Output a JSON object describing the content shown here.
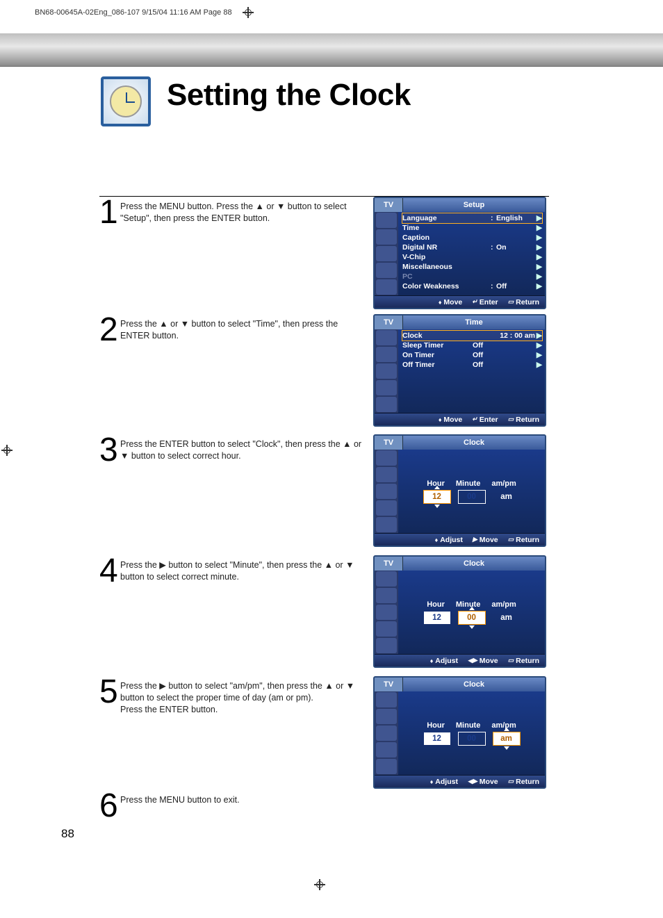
{
  "print_header": "BN68-00645A-02Eng_086-107  9/15/04  11:16 AM  Page 88",
  "page_title": "Setting the Clock",
  "page_number": "88",
  "steps": {
    "s1": {
      "num": "1",
      "text": "Press the MENU button. Press the ▲ or ▼ button to select \"Setup\", then press the ENTER button."
    },
    "s2": {
      "num": "2",
      "text": "Press the ▲ or ▼ button to select \"Time\", then press the ENTER button."
    },
    "s3": {
      "num": "3",
      "text": "Press the ENTER button to select \"Clock\", then press the ▲ or ▼ button to select correct hour."
    },
    "s4": {
      "num": "4",
      "text": "Press the ▶ button to select \"Minute\", then press the ▲ or ▼ button to select correct minute."
    },
    "s5": {
      "num": "5",
      "text": "Press the ▶ button to select \"am/pm\", then press the ▲ or ▼ button to select the proper time of day (am or pm).\nPress the ENTER button."
    },
    "s6": {
      "num": "6",
      "text": "Press the MENU button to exit."
    }
  },
  "osd_tv": "TV",
  "osd1": {
    "title": "Setup",
    "rows": {
      "r0": {
        "label": "Language",
        "value": "English"
      },
      "r1": {
        "label": "Time"
      },
      "r2": {
        "label": "Caption"
      },
      "r3": {
        "label": "Digital NR",
        "value": "On"
      },
      "r4": {
        "label": "V-Chip"
      },
      "r5": {
        "label": "Miscellaneous"
      },
      "r6": {
        "label": "PC"
      },
      "r7": {
        "label": "Color Weakness",
        "value": "Off"
      }
    },
    "foot": {
      "a": "Move",
      "b": "Enter",
      "c": "Return"
    }
  },
  "osd2": {
    "title": "Time",
    "rows": {
      "r0": {
        "label": "Clock",
        "value": "12 : 00 am"
      },
      "r1": {
        "label": "Sleep Timer",
        "value": "Off"
      },
      "r2": {
        "label": "On Timer",
        "value": "Off"
      },
      "r3": {
        "label": "Off Timer",
        "value": "Off"
      }
    },
    "foot": {
      "a": "Move",
      "b": "Enter",
      "c": "Return"
    }
  },
  "osd_clock": {
    "title": "Clock",
    "labels": {
      "hour": "Hour",
      "minute": "Minute",
      "ampm": "am/pm"
    },
    "foot_adjust": "Adjust",
    "foot_move": "Move",
    "foot_return": "Return"
  },
  "clock3": {
    "hour": "12",
    "minute": "00",
    "ampm": "am"
  },
  "clock4": {
    "hour": "12",
    "minute": "00",
    "ampm": "am"
  },
  "clock5": {
    "hour": "12",
    "minute": "00",
    "ampm": "am"
  }
}
